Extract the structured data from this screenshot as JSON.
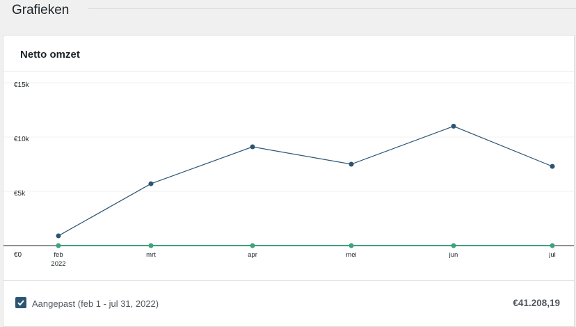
{
  "section": {
    "title": "Grafieken"
  },
  "card": {
    "title": "Netto omzet"
  },
  "chart_data": {
    "type": "line",
    "categories": [
      "feb",
      "mrt",
      "apr",
      "mei",
      "jun",
      "jul"
    ],
    "x_sublabels": [
      "2022",
      "",
      "",
      "",
      "",
      ""
    ],
    "y_ticks": [
      "€0",
      "€5k",
      "€10k",
      "€15k"
    ],
    "ylim": [
      0,
      15000
    ],
    "grid": true,
    "series": [
      {
        "name": "Aangepast (feb 1 - jul 31, 2022)",
        "color": "#2c5573",
        "values": [
          900,
          5700,
          9100,
          7500,
          11000,
          7300
        ]
      },
      {
        "color": "#3ca37a",
        "values": [
          0,
          0,
          0,
          0,
          0,
          0
        ]
      }
    ]
  },
  "legend": {
    "checked": true,
    "label": "Aangepast (feb 1 - jul 31, 2022)",
    "total": "€41.208,19",
    "check_icon": "checkmark-icon"
  }
}
